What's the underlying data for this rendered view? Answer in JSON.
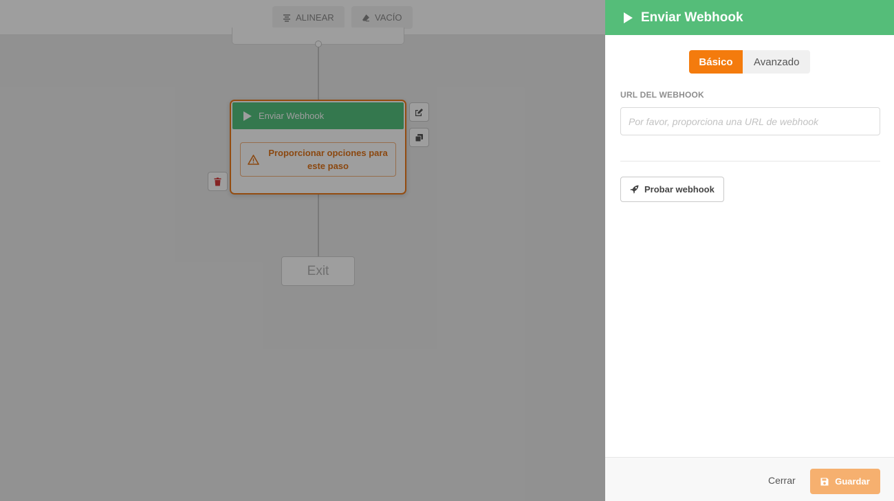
{
  "toolbar": {
    "align_label": "ALINEAR",
    "empty_label": "VACÍO"
  },
  "canvas": {
    "node": {
      "title": "Enviar Webhook",
      "warning": "Proporcionar opciones para este paso"
    },
    "exit_label": "Exit"
  },
  "panel": {
    "title": "Enviar Webhook",
    "tabs": [
      {
        "label": "Básico",
        "active": true
      },
      {
        "label": "Avanzado",
        "active": false
      }
    ],
    "url_field": {
      "label": "URL DEL WEBHOOK",
      "value": "",
      "placeholder": "Por favor, proporciona una URL de webhook"
    },
    "test_button": "Probar webhook",
    "footer": {
      "close_label": "Cerrar",
      "save_label": "Guardar"
    }
  },
  "colors": {
    "accent_green": "#55bd79",
    "accent_orange": "#f47b0d",
    "warning_orange": "#e0741a",
    "save_disabled": "#f6b06f"
  },
  "icons": {
    "align": "align-center-icon",
    "empty": "eraser-icon",
    "play": "play-icon",
    "warning": "warning-triangle-icon",
    "edit": "edit-icon",
    "duplicate": "copy-icon",
    "delete": "trash-icon",
    "test": "rocket-icon",
    "save": "floppy-disk-icon"
  }
}
